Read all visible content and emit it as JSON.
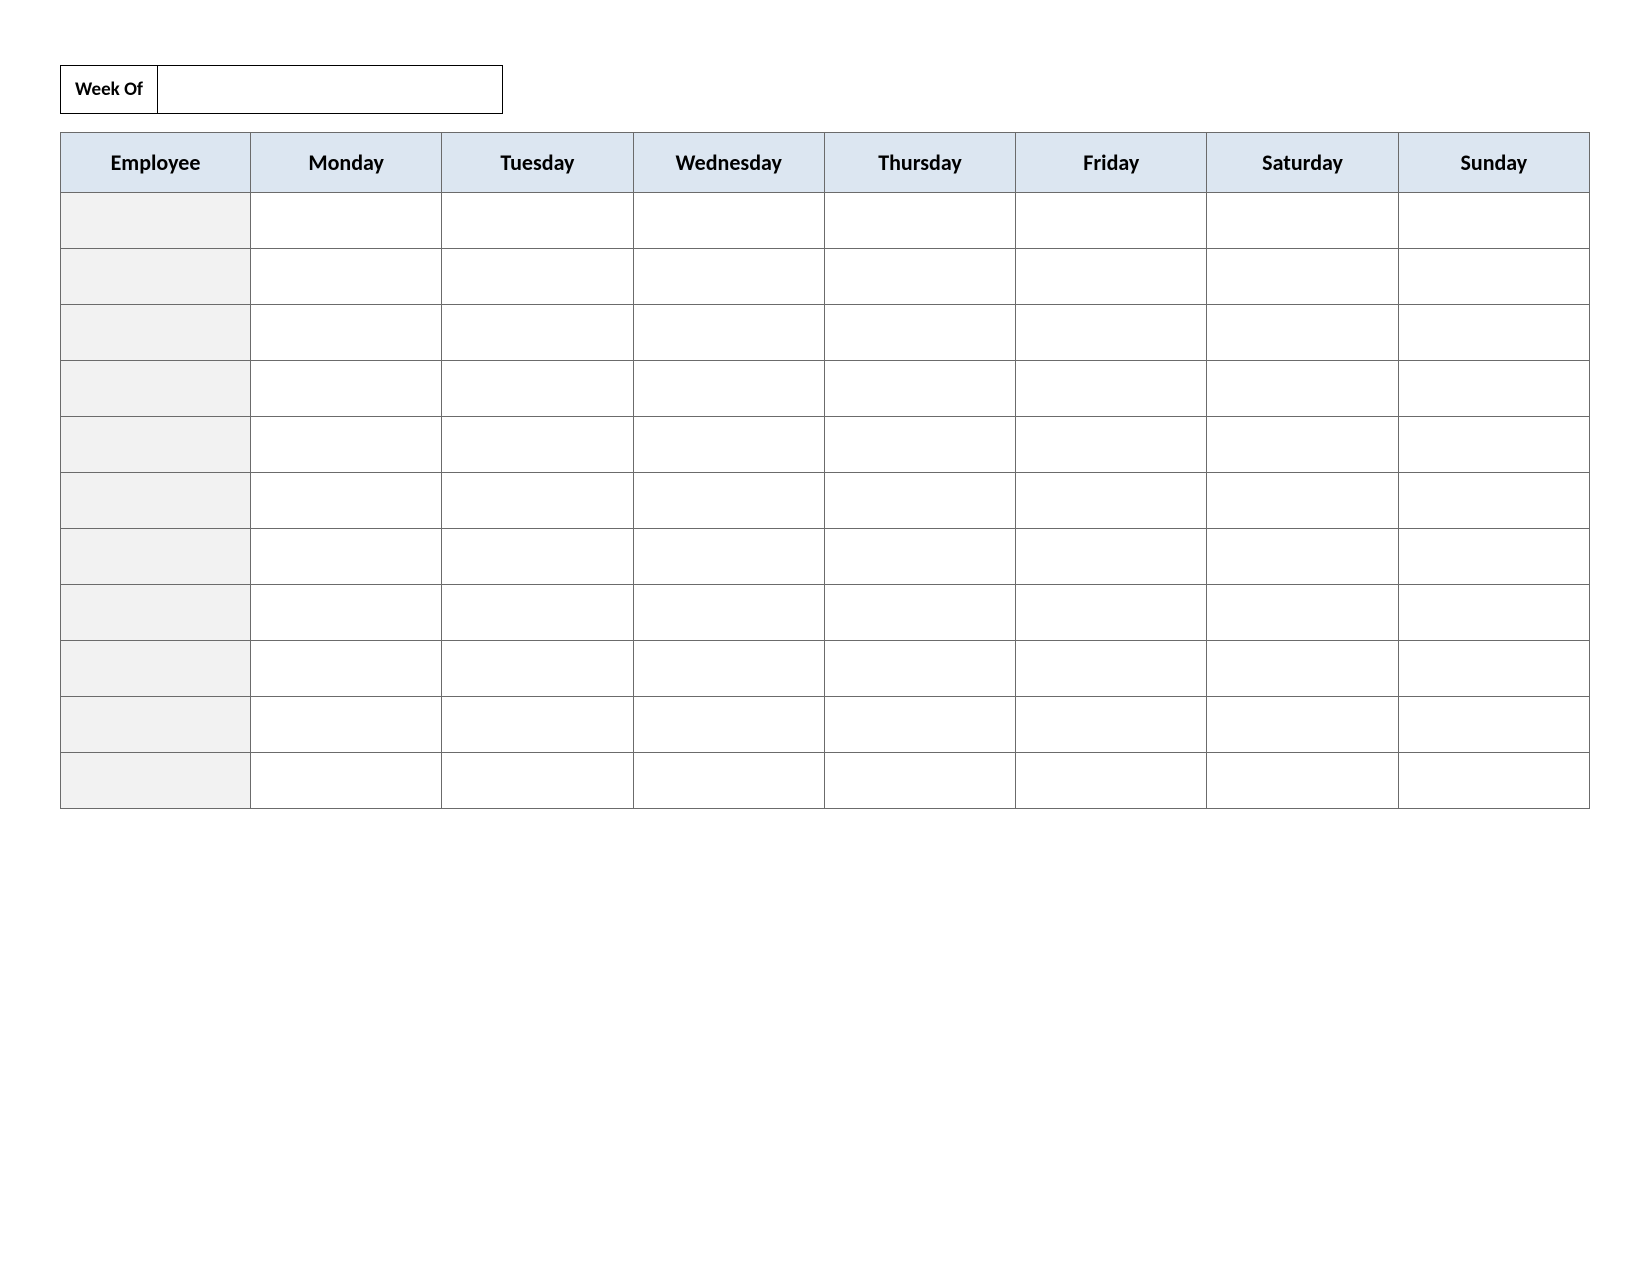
{
  "weekOf": {
    "label": "Week Of",
    "value": ""
  },
  "table": {
    "headers": [
      "Employee",
      "Monday",
      "Tuesday",
      "Wednesday",
      "Thursday",
      "Friday",
      "Saturday",
      "Sunday"
    ],
    "rows": [
      {
        "employee": "",
        "days": [
          "",
          "",
          "",
          "",
          "",
          "",
          ""
        ]
      },
      {
        "employee": "",
        "days": [
          "",
          "",
          "",
          "",
          "",
          "",
          ""
        ]
      },
      {
        "employee": "",
        "days": [
          "",
          "",
          "",
          "",
          "",
          "",
          ""
        ]
      },
      {
        "employee": "",
        "days": [
          "",
          "",
          "",
          "",
          "",
          "",
          ""
        ]
      },
      {
        "employee": "",
        "days": [
          "",
          "",
          "",
          "",
          "",
          "",
          ""
        ]
      },
      {
        "employee": "",
        "days": [
          "",
          "",
          "",
          "",
          "",
          "",
          ""
        ]
      },
      {
        "employee": "",
        "days": [
          "",
          "",
          "",
          "",
          "",
          "",
          ""
        ]
      },
      {
        "employee": "",
        "days": [
          "",
          "",
          "",
          "",
          "",
          "",
          ""
        ]
      },
      {
        "employee": "",
        "days": [
          "",
          "",
          "",
          "",
          "",
          "",
          ""
        ]
      },
      {
        "employee": "",
        "days": [
          "",
          "",
          "",
          "",
          "",
          "",
          ""
        ]
      },
      {
        "employee": "",
        "days": [
          "",
          "",
          "",
          "",
          "",
          "",
          ""
        ]
      }
    ]
  }
}
